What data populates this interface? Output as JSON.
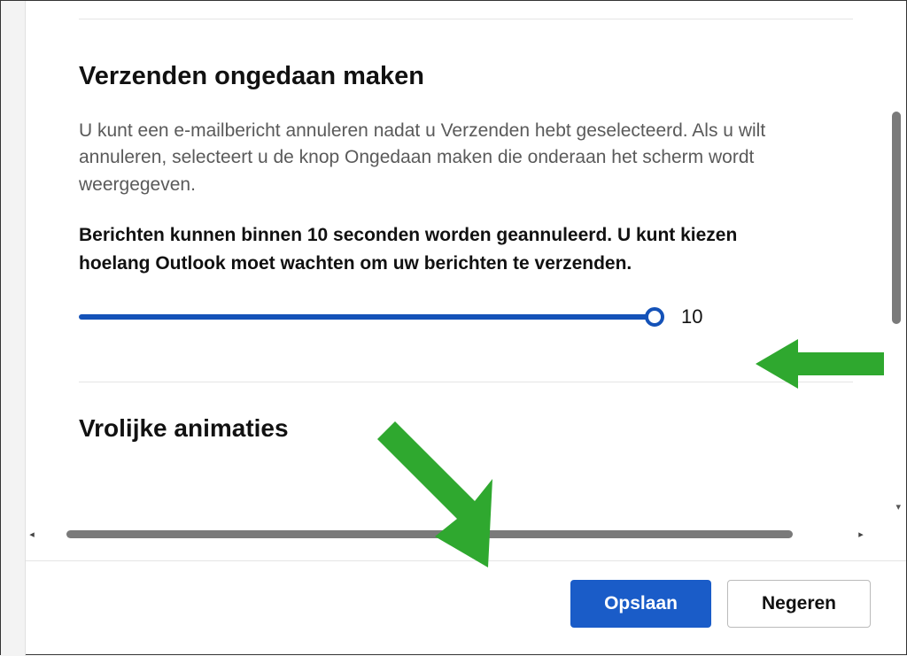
{
  "section": {
    "undo_send": {
      "title": "Verzenden ongedaan maken",
      "description": "U kunt een e-mailbericht annuleren nadat u Verzenden hebt geselecteerd. Als u wilt annuleren, selecteert u de knop Ongedaan maken die onderaan het scherm wordt weergegeven.",
      "instruction": "Berichten kunnen binnen 10 seconden worden geannuleerd. U kunt kiezen hoelang Outlook moet wachten om uw berichten te verzenden.",
      "slider_value": "10"
    },
    "animations": {
      "title": "Vrolijke animaties"
    }
  },
  "footer": {
    "save_label": "Opslaan",
    "cancel_label": "Negeren"
  },
  "colors": {
    "accent": "#1a5cc8",
    "annotation": "#2fa82f"
  }
}
